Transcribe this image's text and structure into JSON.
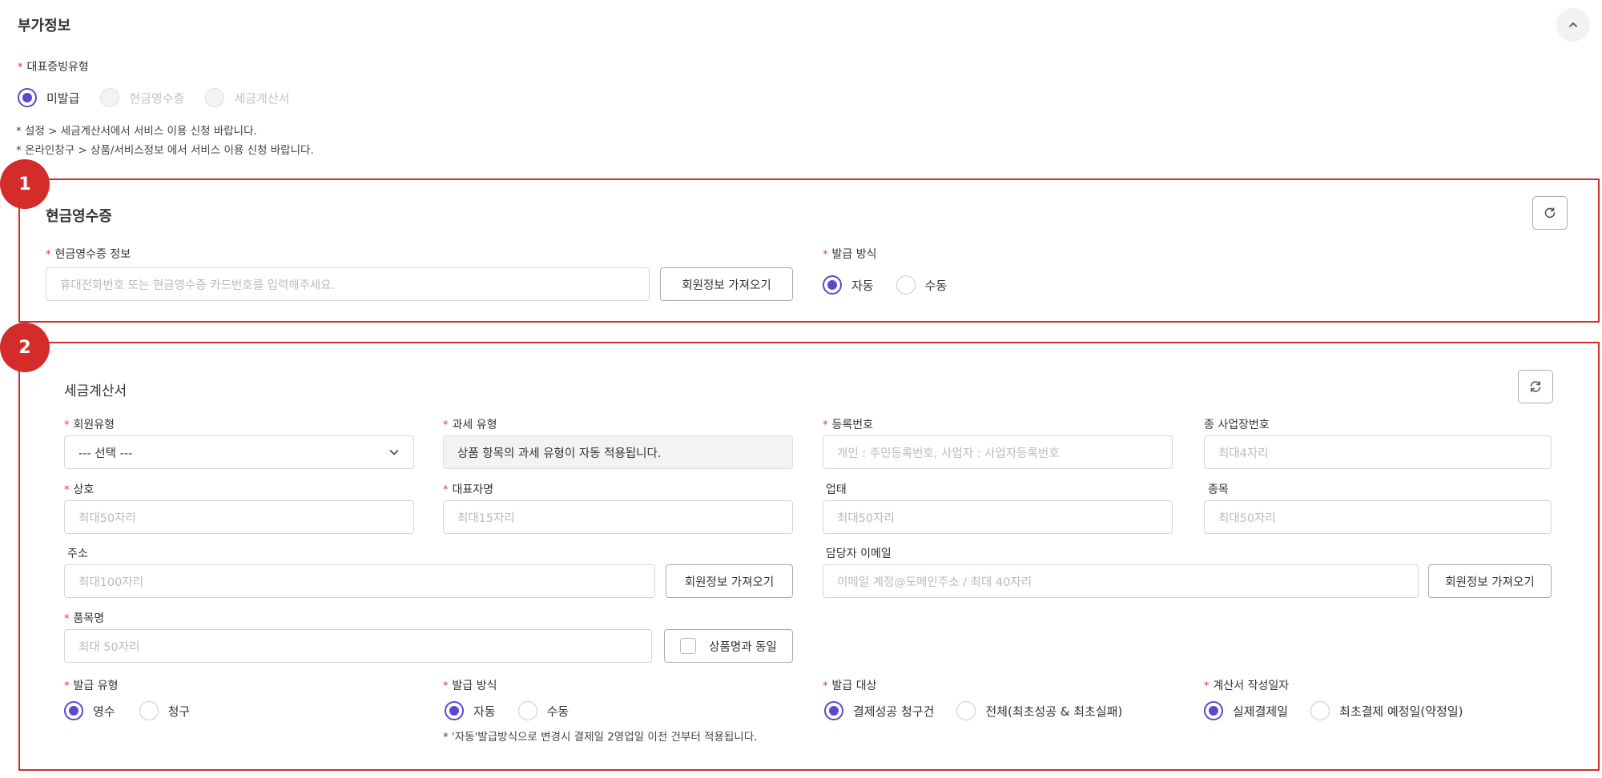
{
  "section": {
    "title": "부가정보"
  },
  "proof_type": {
    "label": "대표증빙유형",
    "options": [
      "미발급",
      "현금영수증",
      "세금계산서"
    ],
    "notes": [
      "* 설정 > 세금계산서에서 서비스 이용 신청 바랍니다.",
      "* 온라인창구 > 상품/서비스정보 에서 서비스 이용 신청 바랍니다."
    ]
  },
  "badges": [
    "1",
    "2"
  ],
  "cash_receipt": {
    "title": "현금영수증",
    "info_label": "현금영수증 정보",
    "info_placeholder": "휴대전화번호 또는 현금영수증 카드번호를 입력해주세요.",
    "fetch_button": "회원정보 가져오기",
    "method_label": "발급 방식",
    "method_options": [
      "자동",
      "수동"
    ]
  },
  "tax_invoice": {
    "title": "세금계산서",
    "member_type": {
      "label": "회원유형",
      "value": "--- 선택 ---"
    },
    "tax_type": {
      "label": "과세 유형",
      "value": "상품 항목의 과세 유형이 자동 적용됩니다."
    },
    "reg_number": {
      "label": "등록번호",
      "placeholder": "개인 : 주민등록번호, 사업자 : 사업자등록번호"
    },
    "sub_business": {
      "label": "종 사업장번호",
      "placeholder": "최대4자리"
    },
    "company": {
      "label": "상호",
      "placeholder": "최대50자리"
    },
    "ceo": {
      "label": "대표자명",
      "placeholder": "최대15자리"
    },
    "business_type": {
      "label": "업태",
      "placeholder": "최대50자리"
    },
    "business_item": {
      "label": "종목",
      "placeholder": "최대50자리"
    },
    "address": {
      "label": "주소",
      "placeholder": "최대100자리",
      "button": "회원정보 가져오기"
    },
    "email": {
      "label": "담당자 이메일",
      "placeholder": "이메일 계정@도메인주소 / 최대 40자리",
      "button": "회원정보 가져오기"
    },
    "item_name": {
      "label": "품목명",
      "placeholder": "최대 50자리",
      "checkbox_label": "상품명과 동일"
    },
    "issue_type": {
      "label": "발급 유형",
      "options": [
        "영수",
        "청구"
      ]
    },
    "issue_method": {
      "label": "발급 방식",
      "options": [
        "자동",
        "수동"
      ],
      "note": "* '자동'발급방식으로 변경시 결제일 2영업일 이전 건부터 적용됩니다."
    },
    "issue_target": {
      "label": "발급 대상",
      "options": [
        "결제성공 청구건",
        "전체(최초성공 & 최초실패)"
      ]
    },
    "invoice_date": {
      "label": "계산서 작성일자",
      "options": [
        "실제결제일",
        "최초결제 예정일(약정일)"
      ]
    }
  },
  "colors": {
    "accent": "#5b4acb",
    "highlight_border": "#d42b2b",
    "required": "#e83535"
  }
}
